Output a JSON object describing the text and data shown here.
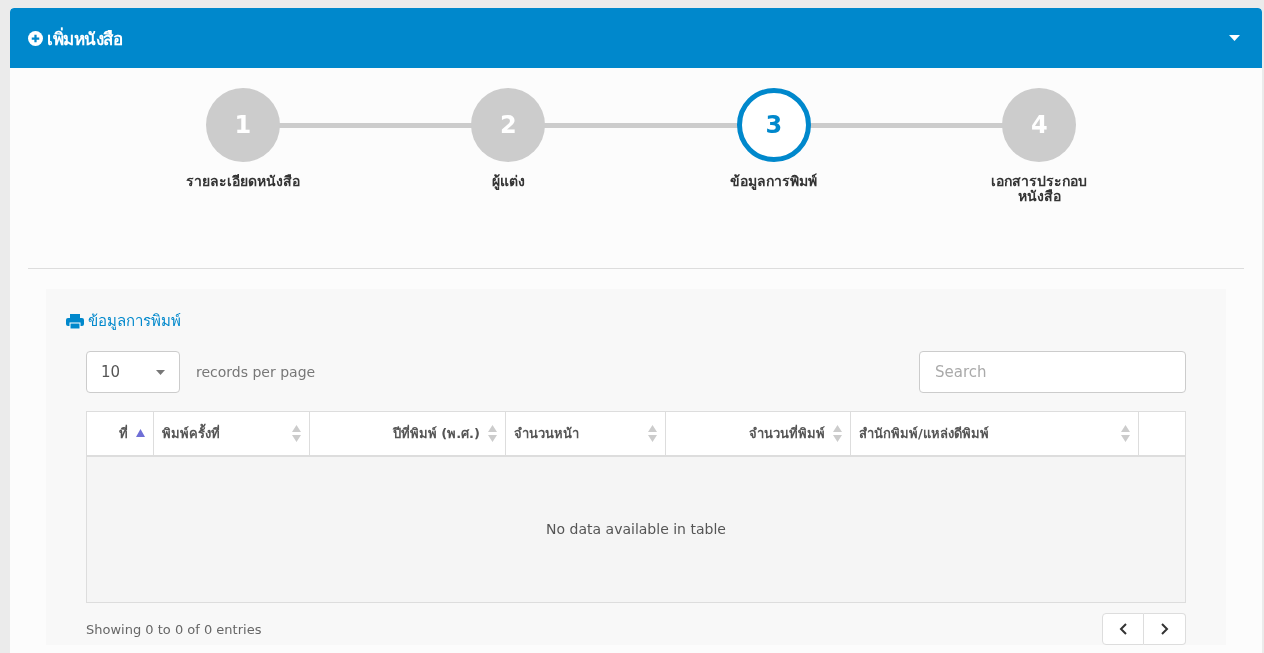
{
  "panel": {
    "title": "เพิ่มหนังสือ"
  },
  "steps": [
    {
      "number": "1",
      "label": "รายละเอียดหนังสือ",
      "selected": false
    },
    {
      "number": "2",
      "label": "ผู้แต่ง",
      "selected": false
    },
    {
      "number": "3",
      "label": "ข้อมูลการพิมพ์",
      "selected": true
    },
    {
      "number": "4",
      "label": "เอกสารประกอบหนังสือ",
      "selected": false
    }
  ],
  "section": {
    "title": "ข้อมูลการพิมพ์"
  },
  "length_select": {
    "value": "10",
    "label": "records per page"
  },
  "search": {
    "placeholder": "Search"
  },
  "table": {
    "columns": [
      {
        "label": "ที่",
        "sorted": true
      },
      {
        "label": "พิมพ์ครั้งที่",
        "sorted": false
      },
      {
        "label": "ปีที่พิมพ์ (พ.ศ.)",
        "sorted": false
      },
      {
        "label": "จำนวนหน้า",
        "sorted": false
      },
      {
        "label": "จำนวนที่พิมพ์",
        "sorted": false
      },
      {
        "label": "สำนักพิมพ์/แหล่งดีพิมพ์",
        "sorted": false
      }
    ],
    "empty_message": "No data available in table"
  },
  "footer": {
    "info": "Showing 0 to 0 of 0 entries"
  }
}
